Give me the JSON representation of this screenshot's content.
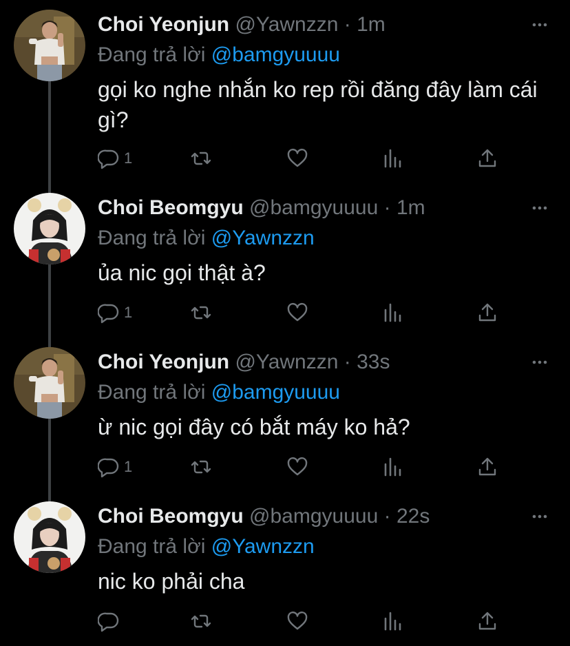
{
  "thread": {
    "tweets": [
      {
        "display_name": "Choi Yeonjun",
        "handle": "@Yawnzzn",
        "dot": "·",
        "time": "1m",
        "reply_prefix": "Đang trả lời",
        "reply_to": "@bamgyuuuu",
        "text": "gọi ko nghe nhắn ko rep rồi đăng đây làm cái gì?",
        "reply_count": "1",
        "avatar": "avatar-yeonjun"
      },
      {
        "display_name": "Choi Beomgyu",
        "handle": "@bamgyuuuu",
        "dot": "·",
        "time": "1m",
        "reply_prefix": "Đang trả lời",
        "reply_to": "@Yawnzzn",
        "text": "ủa nic gọi thật à?",
        "reply_count": "1",
        "avatar": "avatar-beomgyu"
      },
      {
        "display_name": "Choi Yeonjun",
        "handle": "@Yawnzzn",
        "dot": "·",
        "time": "33s",
        "reply_prefix": "Đang trả lời",
        "reply_to": "@bamgyuuuu",
        "text": "ừ nic gọi đây có bắt máy ko hả?",
        "reply_count": "1",
        "avatar": "avatar-yeonjun"
      },
      {
        "display_name": "Choi Beomgyu",
        "handle": "@bamgyuuuu",
        "dot": "·",
        "time": "22s",
        "reply_prefix": "Đang trả lời",
        "reply_to": "@Yawnzzn",
        "text": "nic ko phải cha",
        "reply_count": "",
        "avatar": "avatar-beomgyu"
      }
    ]
  },
  "icons": {
    "reply": "reply-icon",
    "retweet": "retweet-icon",
    "like": "like-icon",
    "analytics": "analytics-icon",
    "share": "share-icon",
    "more": "more-icon"
  },
  "colors": {
    "background": "#000000",
    "text_primary": "#e7e9ea",
    "text_secondary": "#71767b",
    "mention": "#1d9bf0",
    "thread_line": "#3e4144"
  }
}
